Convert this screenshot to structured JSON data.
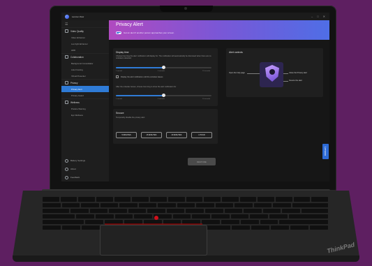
{
  "app": {
    "name": "Lenovo View",
    "window_controls": [
      "–",
      "□",
      "✕"
    ]
  },
  "sidebar": {
    "sections": [
      {
        "label": "Video Quality",
        "icon": "camera-icon",
        "items": [
          "Video Enhancer",
          "Low light Enhancer",
          "HDR"
        ]
      },
      {
        "label": "Collaboration",
        "icon": "people-icon",
        "items": [
          "Background Consolidator",
          "Auto Framing",
          "Virtual Presenter"
        ]
      },
      {
        "label": "Privacy",
        "icon": "shield-icon",
        "items": [
          "Privacy Alert",
          "Privacy Guard"
        ]
      },
      {
        "label": "Wellness",
        "icon": "heart-icon",
        "items": [
          "Posture Warning",
          "Eye Wellness"
        ]
      }
    ],
    "active_item": "Privacy Alert",
    "bottom": [
      {
        "label": "Battery Settings",
        "icon": "gear-icon"
      },
      {
        "label": "About",
        "icon": "info-icon"
      },
      {
        "label": "Feedback",
        "icon": "feedback-icon"
      }
    ]
  },
  "banner": {
    "title": "Privacy Alert",
    "subtitle": "Get an alert if another person approaches your screen."
  },
  "display_time": {
    "title": "Display time",
    "description": "Choose how long the alert notification will display for. The notification will automatically be dismissed when there are no onlookers detected.",
    "slider_value": 0.5,
    "ticks": [
      "1 second",
      "5 seconds",
      "10 seconds"
    ],
    "checkbox_label": "Display the alert notification until the onlooker leaves",
    "second_description": "After the onlooker leaves, choose how long to show the alert notification for",
    "second_slider_value": 0.5,
    "second_ticks": [
      "1 second",
      "5 seconds",
      "10 seconds"
    ]
  },
  "snooze": {
    "title": "Snooze",
    "description": "Temporarily disable the privacy alert",
    "buttons": [
      "5 MINUTES",
      "15 MINUTES",
      "30 MINUTES",
      "1 HOUR"
    ]
  },
  "restore_button": "RESTORE",
  "alert_controls": {
    "title": "Alert controls",
    "labels": [
      "Open the help page",
      "Close the Privacy alert",
      "Snooze the alert"
    ]
  },
  "laptop": {
    "brand": "ThinkPad",
    "side_badge": "Lenovo"
  },
  "colors": {
    "background": "#5e1f61",
    "accent": "#2f7bd6",
    "banner_start": "#b04ac0",
    "banner_end": "#4f6ee6"
  }
}
